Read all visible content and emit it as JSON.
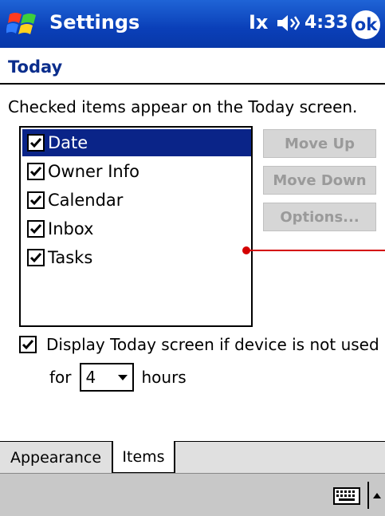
{
  "titlebar": {
    "title": "Settings",
    "connectivity_glyph": "Ix",
    "time": "4:33",
    "ok_label": "ok",
    "icons": [
      "windows-start-icon",
      "connectivity-icon",
      "volume-icon"
    ]
  },
  "page": {
    "title": "Today",
    "instruction": "Checked items appear on the Today screen."
  },
  "items_list": [
    {
      "label": "Date",
      "checked": true,
      "selected": true
    },
    {
      "label": "Owner Info",
      "checked": true,
      "selected": false
    },
    {
      "label": "Calendar",
      "checked": true,
      "selected": false
    },
    {
      "label": "Inbox",
      "checked": true,
      "selected": false
    },
    {
      "label": "Tasks",
      "checked": true,
      "selected": false
    }
  ],
  "buttons": {
    "move_up": "Move Up",
    "move_down": "Move Down",
    "options": "Options..."
  },
  "display_today": {
    "label": "Display Today screen if device is not used",
    "checked": true,
    "for_label": "for",
    "hours_value": "4",
    "hours_label": "hours"
  },
  "tabs": [
    {
      "label": "Appearance",
      "active": false
    },
    {
      "label": "Items",
      "active": true
    }
  ],
  "colors": {
    "titlebar": "#0a3fb8",
    "selection": "#0a2488",
    "page_title": "#0a2d8c",
    "disabled_button_text": "#9a9a9a",
    "marker": "#d40000"
  }
}
